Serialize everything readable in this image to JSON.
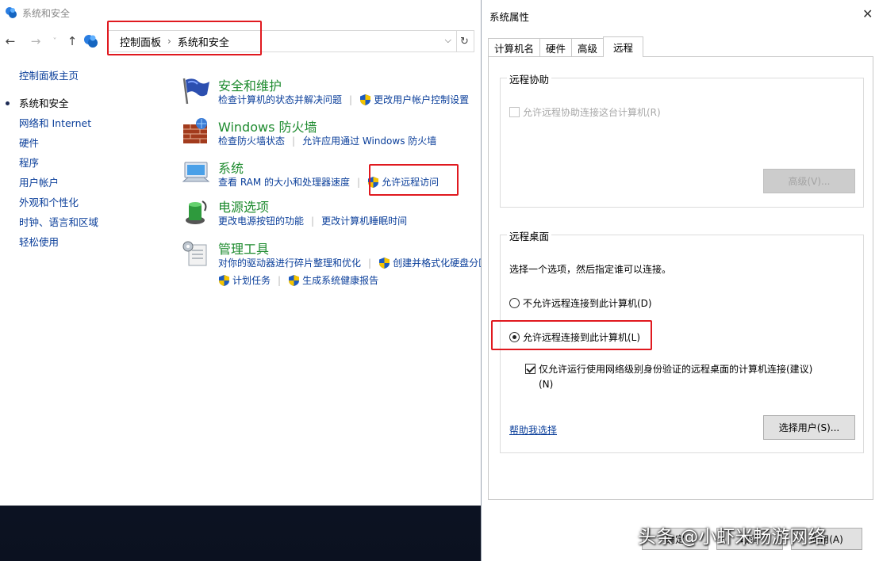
{
  "control_panel": {
    "window_title": "系统和安全",
    "nav": {
      "back": "←",
      "forward": "→",
      "recent": "˅",
      "up": "↑"
    },
    "address": {
      "crumbs": [
        "控制面板",
        "系统和安全"
      ],
      "separator": "›",
      "dropdown": "⌵",
      "refresh": "↻"
    },
    "left_nav": {
      "home": "控制面板主页",
      "items": [
        {
          "label": "系统和安全",
          "current": true
        },
        {
          "label": "网络和 Internet"
        },
        {
          "label": "硬件"
        },
        {
          "label": "程序"
        },
        {
          "label": "用户帐户"
        },
        {
          "label": "外观和个性化"
        },
        {
          "label": "时钟、语言和区域"
        },
        {
          "label": "轻松使用"
        }
      ]
    },
    "categories": {
      "security": {
        "title": "安全和维护",
        "link1": "检查计算机的状态并解决问题",
        "link2": "更改用户帐户控制设置"
      },
      "firewall": {
        "title": "Windows 防火墙",
        "link1": "检查防火墙状态",
        "link2": "允许应用通过 Windows 防火墙"
      },
      "system": {
        "title": "系统",
        "link1": "查看 RAM 的大小和处理器速度",
        "link2": "允许远程访问"
      },
      "power": {
        "title": "电源选项",
        "link1": "更改电源按钮的功能",
        "link2": "更改计算机睡眠时间"
      },
      "admin": {
        "title": "管理工具",
        "link1": "对你的驱动器进行碎片整理和优化",
        "link2": "创建并格式化硬盘分区",
        "link3": "计划任务",
        "link4": "生成系统健康报告"
      }
    }
  },
  "dialog": {
    "title": "系统属性",
    "close": "✕",
    "tabs": [
      "计算机名",
      "硬件",
      "高级",
      "远程"
    ],
    "remote_assistance": {
      "group_title": "远程协助",
      "allow_label": "允许远程协助连接这台计算机(R)",
      "advanced_button": "高级(V)..."
    },
    "remote_desktop": {
      "group_title": "远程桌面",
      "instruction": "选择一个选项，然后指定谁可以连接。",
      "option_deny": "不允许远程连接到此计算机(D)",
      "option_allow": "允许远程连接到此计算机(L)",
      "nla_label_line1": "仅允许运行使用网络级别身份验证的远程桌面的计算机连接(建议)",
      "nla_label_line2": "(N)",
      "help_link": "帮助我选择",
      "select_users_button": "选择用户(S)..."
    },
    "bottom_buttons": [
      "确定",
      "取消",
      "应用(A)"
    ]
  },
  "watermark": "头条 @小虾米畅游网络"
}
